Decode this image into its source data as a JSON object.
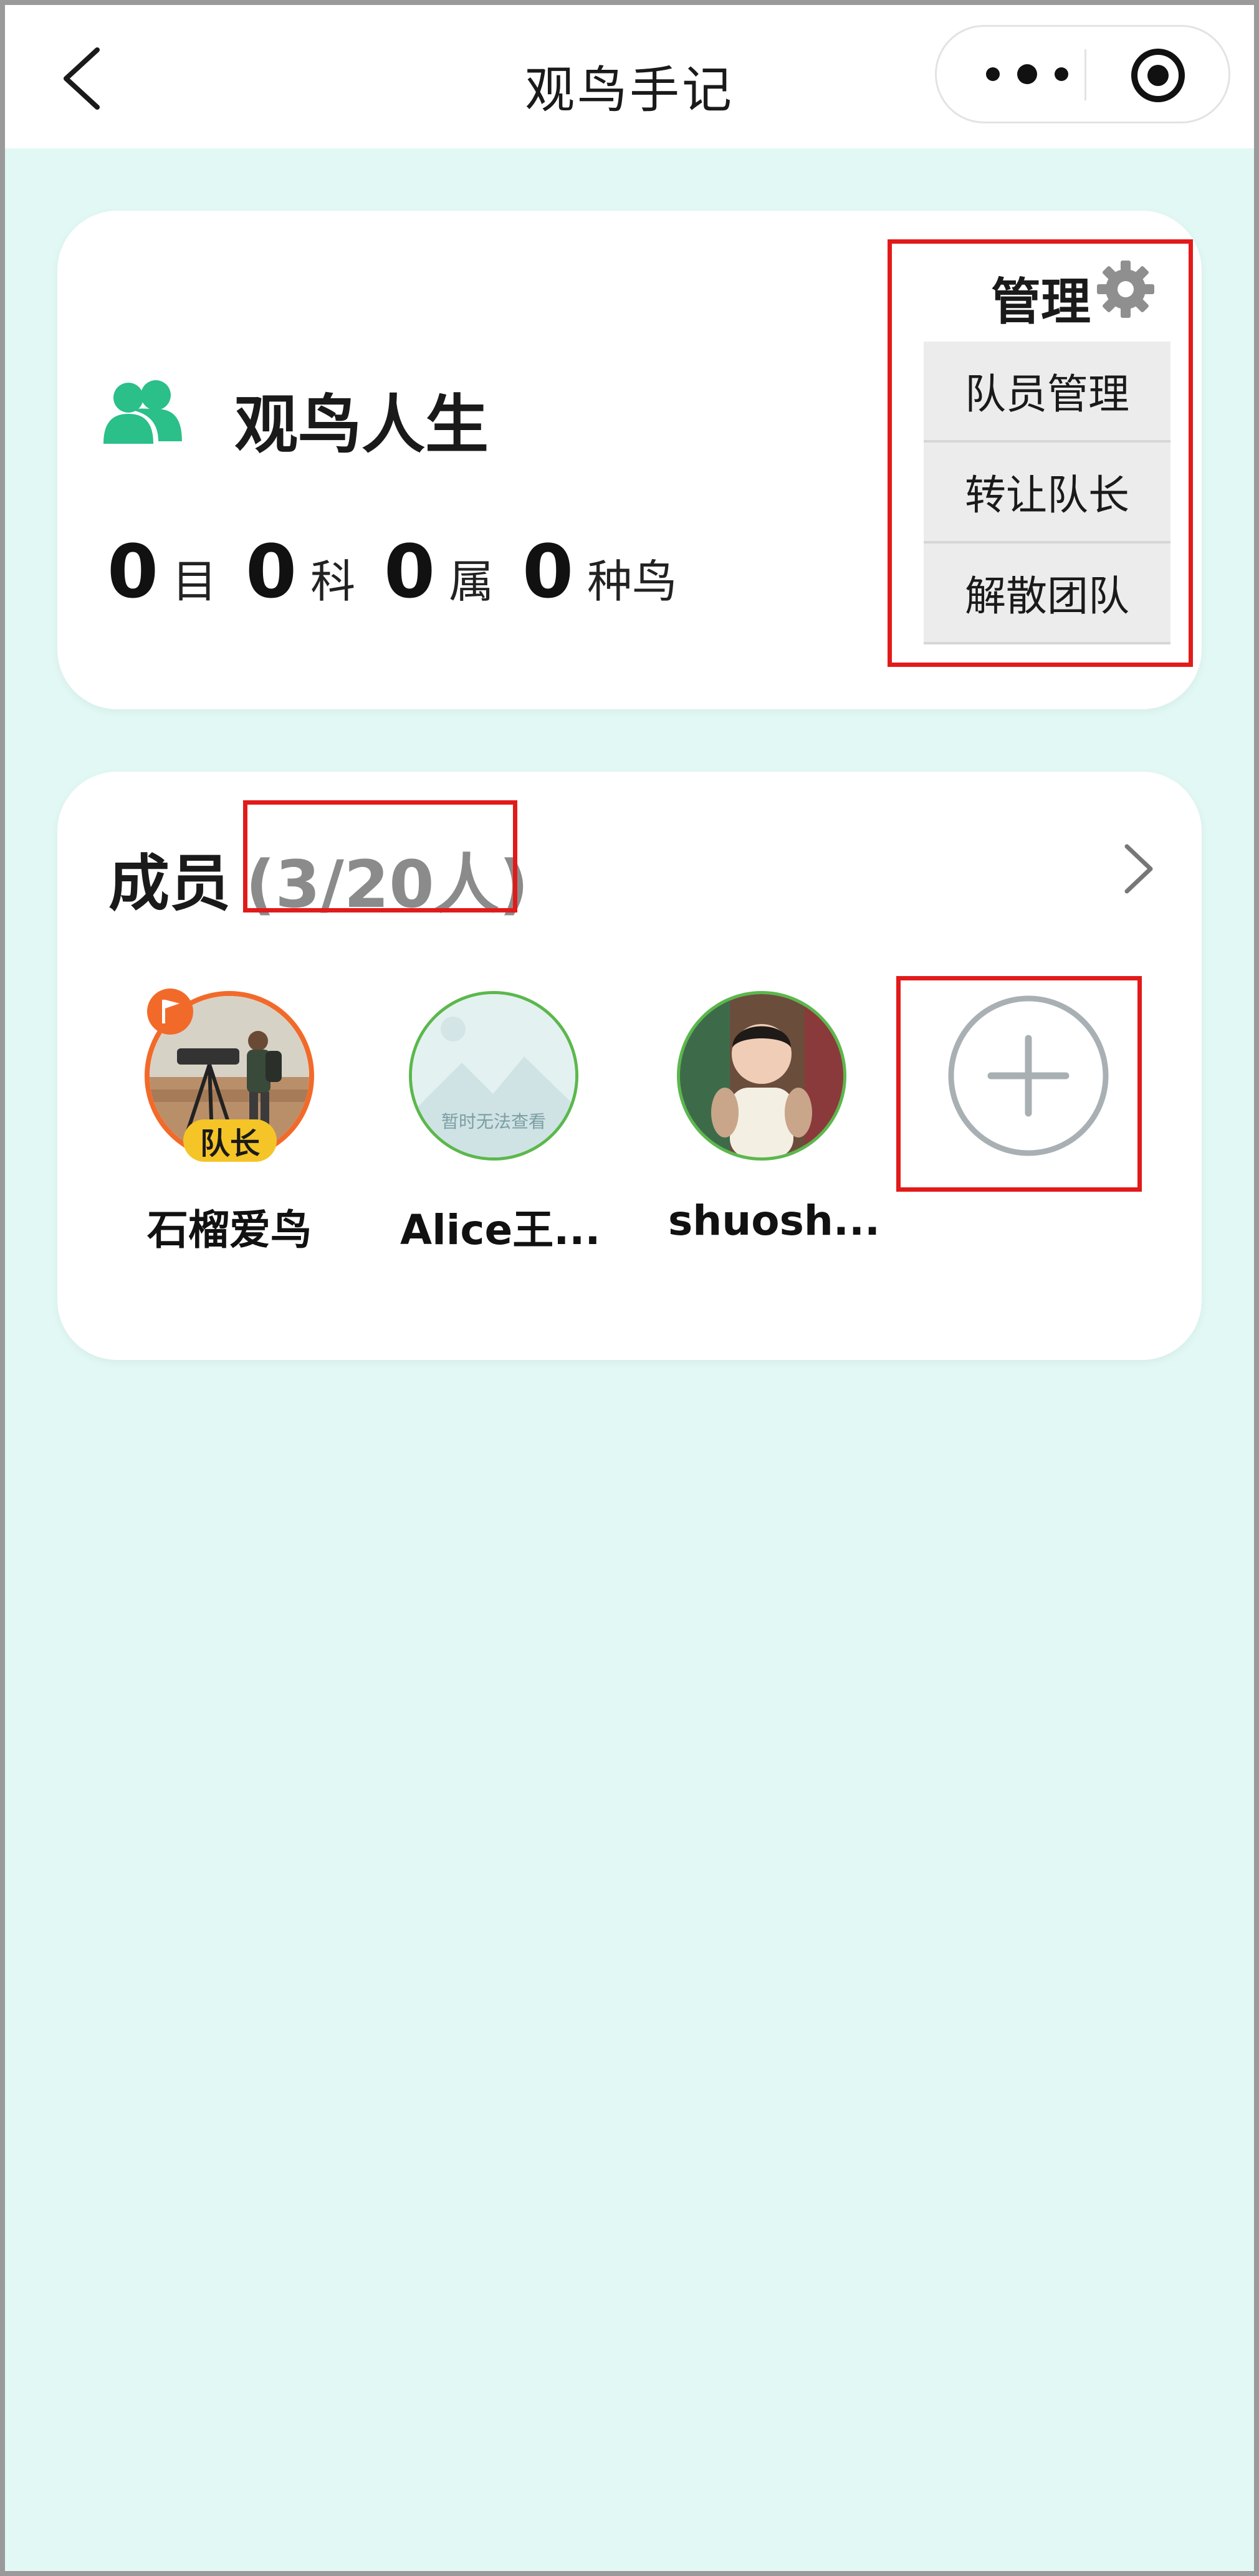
{
  "nav": {
    "title": "观鸟手记",
    "back_icon": "chevron-left-icon",
    "more_icon": "more-dots-icon",
    "close_icon": "target-circle-icon"
  },
  "team": {
    "name": "观鸟人生",
    "icon": "team-people-icon",
    "icon_color": "#2bbf8a",
    "stats": [
      {
        "value": "0",
        "unit": "目"
      },
      {
        "value": "0",
        "unit": "科"
      },
      {
        "value": "0",
        "unit": "属"
      },
      {
        "value": "0",
        "unit": "种鸟"
      }
    ],
    "manage": {
      "title": "管理",
      "icon": "gear-icon",
      "items": [
        "队员管理",
        "转让队长",
        "解散团队"
      ]
    }
  },
  "members": {
    "title": "成员",
    "count": "(3/20人)",
    "list": [
      {
        "name": "石榴爱鸟",
        "badge": "队长",
        "is_leader": true
      },
      {
        "name": "Alice王...",
        "avatar_text": "暂时无法查看"
      },
      {
        "name": "shuosh..."
      }
    ],
    "add_icon": "plus-circle-icon"
  },
  "colors": {
    "background": "#e2f8f4",
    "accent_green": "#2bbf8a",
    "highlight_red": "#e21a1a",
    "leader_ring": "#f26a2a",
    "leader_badge": "#f5c427"
  }
}
